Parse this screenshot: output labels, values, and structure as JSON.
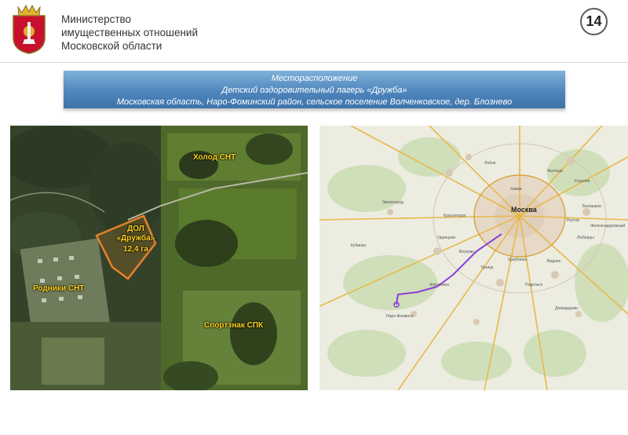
{
  "header": {
    "org_lines": [
      "Министерство",
      "имущественных отношений",
      "Московской области"
    ],
    "page_number": "14",
    "logo_icon": "moscow-oblast-coat-of-arms"
  },
  "banner": {
    "lines": [
      "Месторасположение",
      "Детский оздоровительный лагерь «Дружба»",
      "Московская область, Наро-Фоминский район, сельское поселение Волченковское, дер. Блознево"
    ]
  },
  "satellite": {
    "labels": {
      "holod": "Холод СНТ",
      "camp_line1": "ДОЛ",
      "camp_line2": "«Дружба»",
      "camp_area": "12,4 га",
      "rodniki": "Родники СНТ",
      "sportznak": "Спортзнак СПК"
    }
  },
  "overview_map": {
    "city_label": "Москва",
    "places": [
      "Химки",
      "Красногорск",
      "Одинцово",
      "Подольск",
      "Видное",
      "Троицк",
      "Люберцы",
      "Балашиха",
      "Мытищи",
      "Королёв",
      "Домодедово",
      "Апрелевка",
      "Наро-Фоминск",
      "Звенигород",
      "Кубинка",
      "Внуково",
      "Щербинка",
      "Реутов",
      "Железнодорожный",
      "Лобня"
    ]
  }
}
